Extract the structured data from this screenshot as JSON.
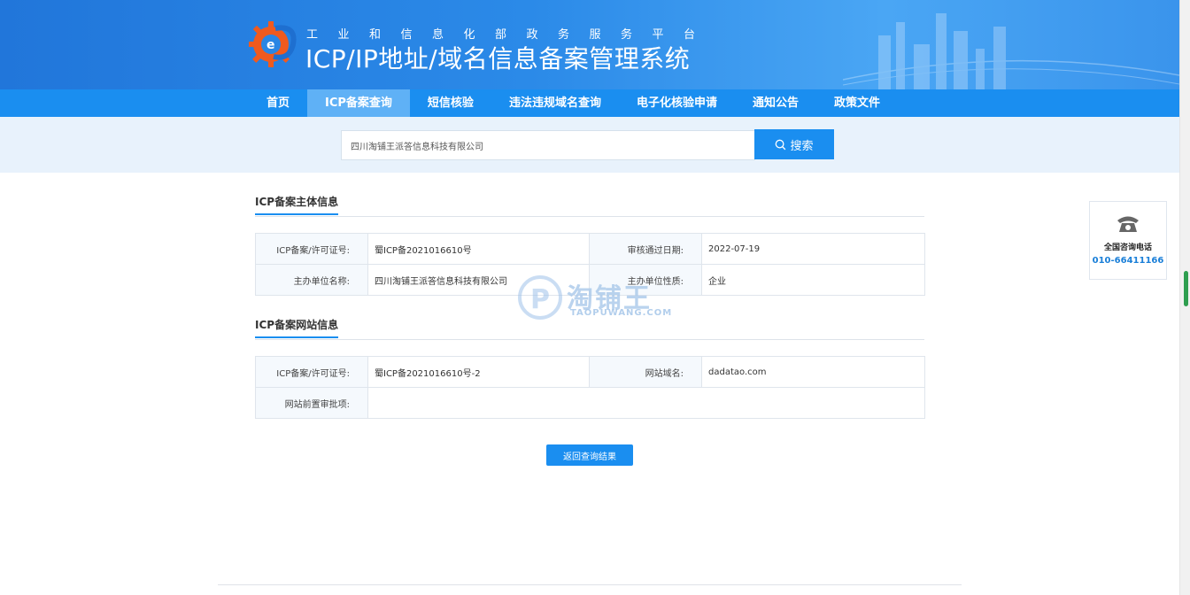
{
  "header": {
    "subtitle": "工业和信息化部政务服务平台",
    "title": "ICP/IP地址/域名信息备案管理系统",
    "colors": {
      "banner": "#2b8ae8",
      "nav": "#1a8ef0",
      "nav_active": "#5fb1f6",
      "logo_orange": "#f05a1e"
    }
  },
  "nav": {
    "items": [
      "首页",
      "ICP备案查询",
      "短信核验",
      "违法违规域名查询",
      "电子化核验申请",
      "通知公告",
      "政策文件"
    ],
    "active": "ICP备案查询"
  },
  "search": {
    "value": "四川淘铺王派答信息科技有限公司",
    "button_label": "搜索",
    "icon": "search-icon"
  },
  "subject": {
    "title": "ICP备案主体信息",
    "rows": [
      {
        "l1": "ICP备案/许可证号:",
        "v1": "蜀ICP备2021016610号",
        "l2": "审核通过日期:",
        "v2": "2022-07-19"
      },
      {
        "l1": "主办单位名称:",
        "v1": "四川淘铺王派答信息科技有限公司",
        "l2": "主办单位性质:",
        "v2": "企业"
      }
    ]
  },
  "website": {
    "title": "ICP备案网站信息",
    "rows": [
      {
        "l1": "ICP备案/许可证号:",
        "v1": "蜀ICP备2021016610号-2",
        "l2": "网站域名:",
        "v2": "dadatao.com"
      },
      {
        "l1": "网站前置审批项:",
        "v1": ""
      }
    ]
  },
  "watermark": {
    "text": "淘铺王",
    "sub": "TAOPUWANG.COM"
  },
  "return_button": "返回查询结果",
  "consult": {
    "label": "全国咨询电话",
    "phone": "010-66411166",
    "icon": "phone-icon"
  }
}
